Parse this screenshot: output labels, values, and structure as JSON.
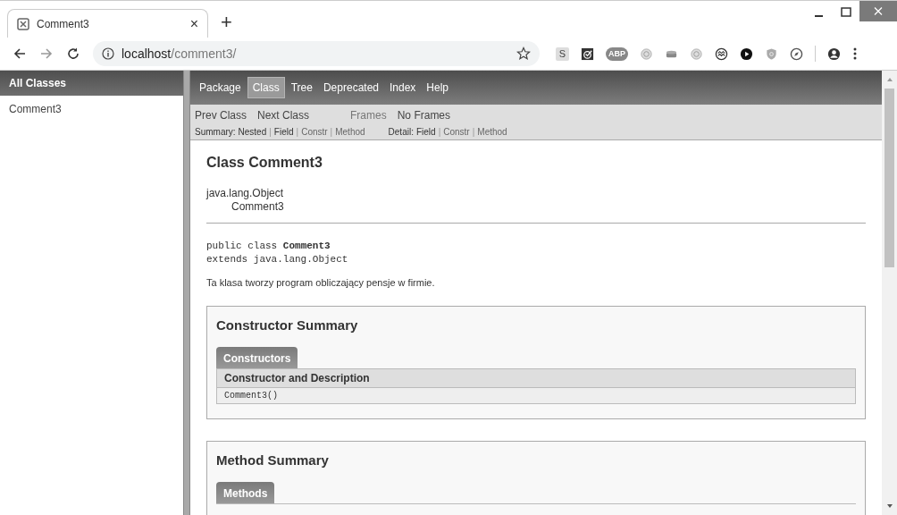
{
  "browser": {
    "tab": {
      "title": "Comment3",
      "close": "×"
    },
    "new_tab": "+",
    "address": {
      "host": "localhost",
      "path": "/comment3/"
    },
    "extensions": [
      {
        "kind": "letter",
        "label": "S"
      },
      {
        "kind": "check"
      },
      {
        "kind": "octagon",
        "label": "ABP"
      },
      {
        "kind": "ring"
      },
      {
        "kind": "cylinder"
      },
      {
        "kind": "ring"
      },
      {
        "kind": "sync"
      },
      {
        "kind": "play"
      },
      {
        "kind": "shield"
      },
      {
        "kind": "compass"
      }
    ]
  },
  "left_frame": {
    "header": "All Classes",
    "items": [
      "Comment3"
    ]
  },
  "nav": [
    {
      "label": "Package",
      "selected": false
    },
    {
      "label": "Class",
      "selected": true
    },
    {
      "label": "Tree",
      "selected": false
    },
    {
      "label": "Deprecated",
      "selected": false
    },
    {
      "label": "Index",
      "selected": false
    },
    {
      "label": "Help",
      "selected": false
    }
  ],
  "subnav": {
    "separator": "|",
    "links": [
      "Prev Class",
      "Next Class"
    ],
    "frames": [
      "Frames",
      "No Frames"
    ],
    "summary": {
      "label": "Summary:",
      "items": [
        {
          "label": "Nested",
          "link": false
        },
        {
          "label": "Field",
          "link": false
        },
        {
          "label": "Constr",
          "link": true
        },
        {
          "label": "Method",
          "link": true
        }
      ]
    },
    "detail": {
      "label": "Detail:",
      "items": [
        {
          "label": "Field",
          "link": false
        },
        {
          "label": "Constr",
          "link": true
        },
        {
          "label": "Method",
          "link": true
        }
      ]
    }
  },
  "class": {
    "title": "Class Comment3",
    "inheritance": [
      "java.lang.Object",
      "Comment3"
    ],
    "signature": {
      "prefix": "public class ",
      "name": "Comment3",
      "extends": "extends java.lang.Object"
    },
    "description": "Ta klasa tworzy program obliczający pensje w firmie."
  },
  "sections": [
    {
      "title": "Constructor Summary",
      "tab": "Constructors",
      "header": "Constructor and Description",
      "rows": [
        "Comment3()"
      ]
    },
    {
      "title": "Method Summary",
      "tab": "Methods"
    }
  ]
}
